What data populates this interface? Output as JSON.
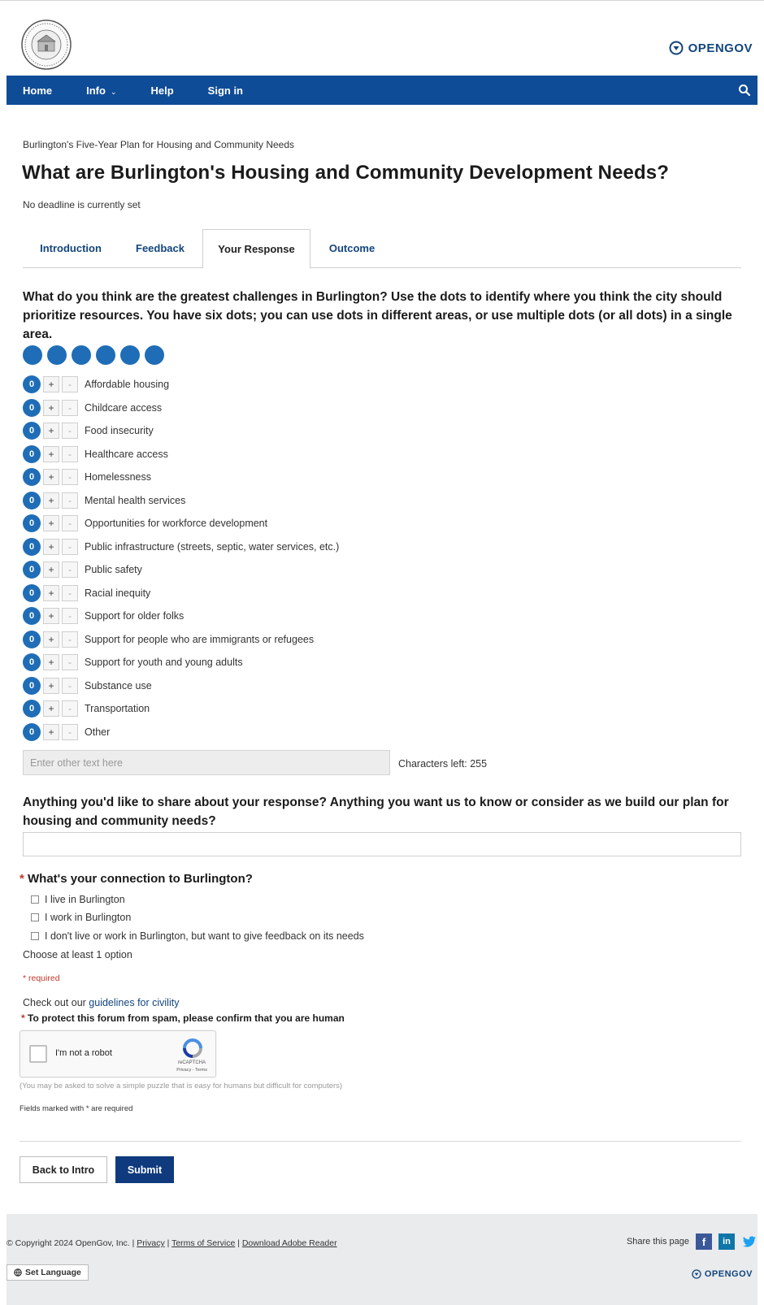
{
  "brand": {
    "name": "OPENGOV",
    "color": "#12457d"
  },
  "nav": {
    "items": [
      {
        "label": "Home"
      },
      {
        "label": "Info"
      },
      {
        "label": "Help"
      },
      {
        "label": "Sign in"
      }
    ],
    "info_caret": "⌄",
    "search_icon": "search-icon",
    "background": "#0f4c97"
  },
  "breadcrumb": "Burlington's Five-Year Plan for Housing and Community Needs",
  "title": "What are Burlington's Housing and Community Development Needs?",
  "deadline": "No deadline is currently set",
  "tabs": [
    {
      "label": "Introduction",
      "active": false
    },
    {
      "label": "Feedback",
      "active": false
    },
    {
      "label": "Your Response",
      "active": true
    },
    {
      "label": "Outcome",
      "active": false
    }
  ],
  "dots_question": "What do you think are the greatest challenges in Burlington? Use the dots to identify where you think the city should prioritize resources. You have six dots; you can use dots in different areas, or use multiple dots (or all dots) in a single area.",
  "dots_remaining": 6,
  "options": [
    {
      "count": "0",
      "label": "Affordable housing"
    },
    {
      "count": "0",
      "label": "Childcare access"
    },
    {
      "count": "0",
      "label": "Food insecurity"
    },
    {
      "count": "0",
      "label": "Healthcare access"
    },
    {
      "count": "0",
      "label": "Homelessness"
    },
    {
      "count": "0",
      "label": "Mental health services"
    },
    {
      "count": "0",
      "label": "Opportunities for workforce development"
    },
    {
      "count": "0",
      "label": "Public infrastructure (streets, septic, water services, etc.)"
    },
    {
      "count": "0",
      "label": "Public safety"
    },
    {
      "count": "0",
      "label": "Racial inequity"
    },
    {
      "count": "0",
      "label": "Support for older folks"
    },
    {
      "count": "0",
      "label": "Support for people who are immigrants or refugees"
    },
    {
      "count": "0",
      "label": "Support for youth and young adults"
    },
    {
      "count": "0",
      "label": "Substance use"
    },
    {
      "count": "0",
      "label": "Transportation"
    },
    {
      "count": "0",
      "label": "Other"
    }
  ],
  "plus_label": "+",
  "minus_label": "-",
  "other_input": {
    "placeholder": "Enter other text here",
    "value": ""
  },
  "chars_left": "Characters left: 255",
  "share_question": "Anything you'd like to share about your response? Anything you want us to know or consider as we build our plan for housing and community needs?",
  "share_input": {
    "value": ""
  },
  "connection": {
    "star": "*",
    "title": "What's your connection to Burlington?",
    "options": [
      {
        "label": "I live in Burlington",
        "checked": false
      },
      {
        "label": "I work in Burlington",
        "checked": false
      },
      {
        "label": "I don't live or work in Burlington, but want to give feedback on its needs",
        "checked": false
      }
    ],
    "hint": "Choose at least 1 option"
  },
  "required_note": "* required",
  "civility": {
    "prefix": "Check out our ",
    "link": "guidelines for civility"
  },
  "spam": {
    "star": "*",
    "label": "To protect this forum from spam, please confirm that you are human"
  },
  "recaptcha": {
    "label": "I'm not a robot",
    "brand": "reCAPTCHA",
    "links": "Privacy - Terms"
  },
  "puzzle_note": "(You may be asked to solve a simple puzzle that is easy for humans but difficult for computers)",
  "fields_note": "Fields marked with * are required",
  "buttons": {
    "back": "Back to Intro",
    "submit": "Submit"
  },
  "footer": {
    "copyright_prefix": "© Copyright 2024 OpenGov, Inc. | ",
    "links": [
      "Privacy",
      "Terms of Service",
      "Download Adobe Reader"
    ],
    "share_label": "Share this page",
    "social": {
      "facebook": "f",
      "linkedin": "in",
      "twitter": "🐦"
    },
    "set_language": "Set Language",
    "brand": "OPENGOV"
  },
  "colors": {
    "accent": "#1f6db7",
    "nav": "#0f4c97",
    "submit": "#0f3a7d",
    "required": "#c0392b"
  }
}
